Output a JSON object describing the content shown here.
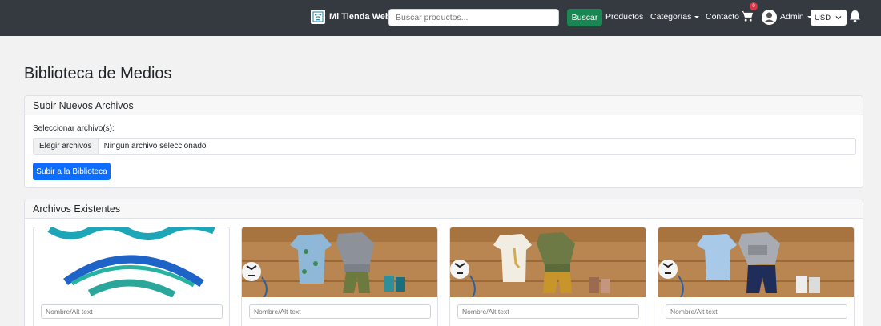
{
  "navbar": {
    "brand": "Mi Tienda Web",
    "search_placeholder": "Buscar productos...",
    "search_button": "Buscar",
    "links": {
      "products": "Productos",
      "categories": "Categorías",
      "contact": "Contacto"
    },
    "cart_count": "0",
    "user": "Admin",
    "currency": "USD"
  },
  "page": {
    "title": "Biblioteca de Medios"
  },
  "upload": {
    "header": "Subir Nuevos Archivos",
    "label": "Seleccionar archivo(s):",
    "choose_button": "Elegir archivos",
    "no_file": "Ningún archivo seleccionado",
    "submit": "Subir a la Biblioteca"
  },
  "existing": {
    "header": "Archivos Existentes",
    "items": [
      {
        "image": "logo-waves",
        "alt_placeholder": "Nombre/Alt text"
      },
      {
        "image": "baby-clothes-dinosaur",
        "alt_placeholder": "Nombre/Alt text"
      },
      {
        "image": "baby-clothes-giraffe",
        "alt_placeholder": "Nombre/Alt text"
      },
      {
        "image": "baby-clothes-explorer",
        "alt_placeholder": "Nombre/Alt text"
      }
    ]
  },
  "colors": {
    "navbar": "#343a40",
    "search_button": "#198754",
    "primary": "#0d6efd",
    "badge": "#dc3545"
  }
}
